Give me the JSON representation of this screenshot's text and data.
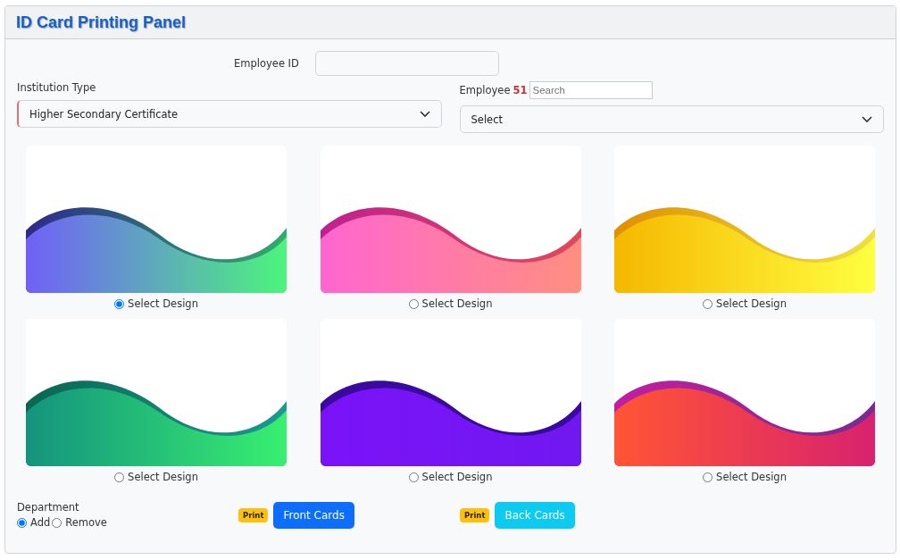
{
  "panel": {
    "title": "ID Card Printing Panel"
  },
  "employee_id": {
    "label": "Employee ID"
  },
  "institution_type": {
    "label": "Institution Type",
    "value": "Higher Secondary Certificate"
  },
  "employee": {
    "label": "Employee",
    "count": "51",
    "search_placeholder": "Search",
    "value": "Select"
  },
  "designs": [
    {
      "selected": true,
      "label": "Select Design",
      "color": "#7060f8"
    },
    {
      "selected": false,
      "label": "Select Design",
      "color": "#ff66d0"
    },
    {
      "selected": false,
      "label": "Select Design",
      "color": "#f5b800"
    },
    {
      "selected": false,
      "label": "Select Design",
      "color": "#14937e"
    },
    {
      "selected": false,
      "label": "Select Design",
      "color": "#7a12f8"
    },
    {
      "selected": false,
      "label": "Select Design",
      "color": "#ff5535"
    }
  ],
  "department": {
    "label": "Department",
    "options": [
      {
        "label": "Add",
        "selected": true
      },
      {
        "label": "Remove",
        "selected": false
      }
    ]
  },
  "actions": [
    {
      "badge": "Print",
      "label": "Front Cards",
      "kind": "primary"
    },
    {
      "badge": "Print",
      "label": "Back Cards",
      "kind": "info"
    }
  ]
}
